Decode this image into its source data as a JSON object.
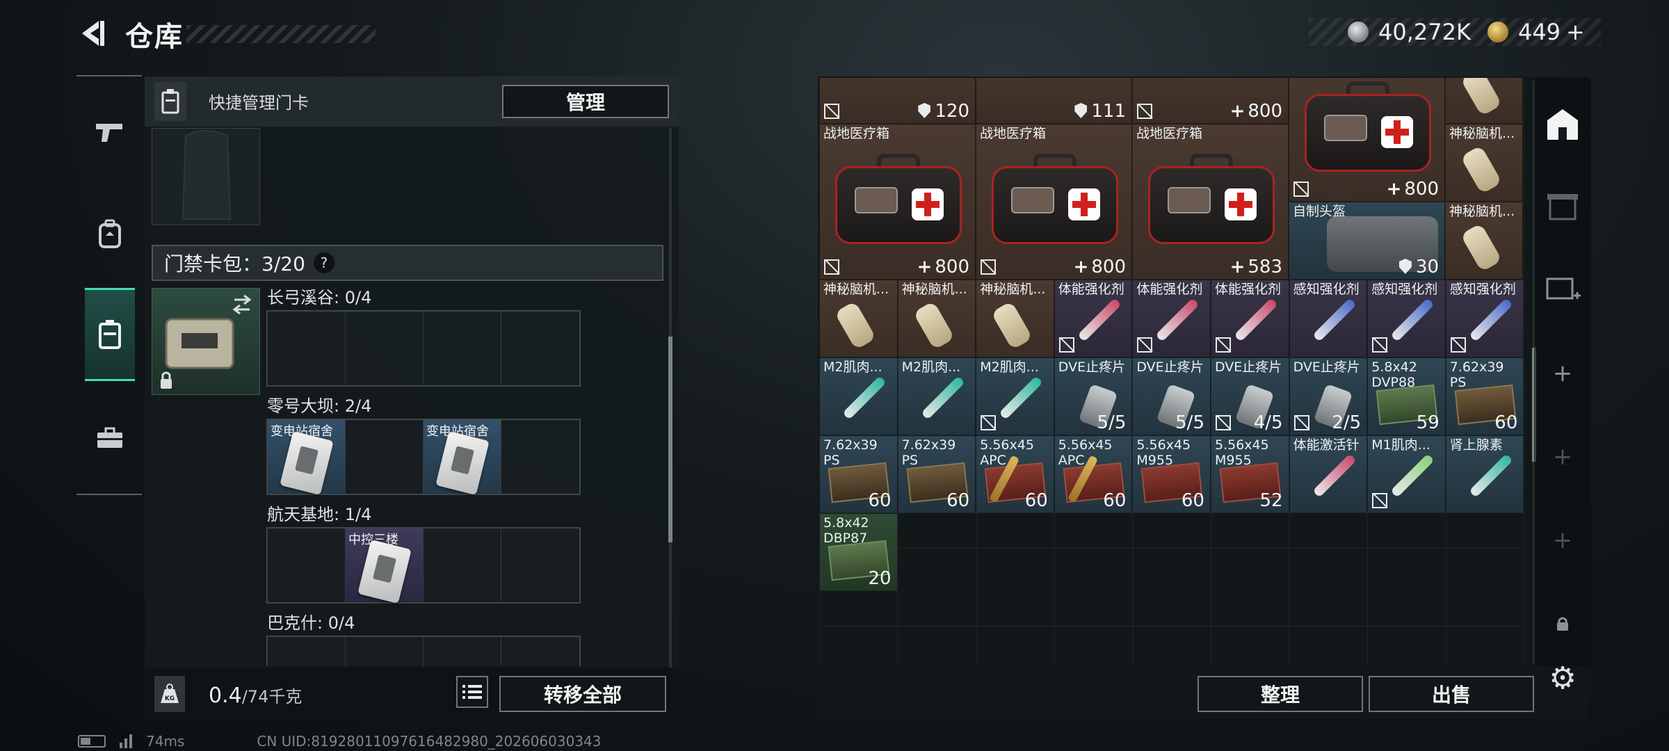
{
  "header": {
    "title": "仓库",
    "currency_silver": "40,272K",
    "currency_gold": "449",
    "gold_add": "+"
  },
  "nav": [
    {
      "icon": "pistol-icon"
    },
    {
      "icon": "backpack-icon"
    },
    {
      "icon": "keycard-icon",
      "active": true
    },
    {
      "icon": "toolbox-icon"
    }
  ],
  "left": {
    "quick_label": "快捷管理门卡",
    "manage_label": "管理",
    "cardbag_label": "门禁卡包：3/20",
    "cardbag_help": "?",
    "regions": [
      {
        "label": "长弓溪谷: 0/4",
        "slots": [
          null,
          null,
          null,
          null
        ]
      },
      {
        "label": "零号大坝: 2/4",
        "slots": [
          {
            "name": "变电站宿舍"
          },
          null,
          {
            "name": "变电站宿舍"
          },
          null
        ]
      },
      {
        "label": "航天基地: 1/4",
        "slots": [
          null,
          {
            "name": "中控三楼"
          },
          null,
          null
        ]
      },
      {
        "label": "巴克什: 0/4",
        "slots": [
          null,
          null,
          null,
          null
        ]
      }
    ],
    "weight_value": "0.4",
    "weight_max": "/74千克",
    "transfer_label": "转移全部"
  },
  "status": {
    "ping": "74ms",
    "uid": "CN UID:8192801109761648298​0_202606030343"
  },
  "right": {
    "top_row": [
      {
        "count": "120",
        "kind": "shield"
      },
      {
        "count": "111",
        "kind": "shield"
      },
      {
        "count": "800",
        "kind": "plus"
      }
    ],
    "items": [
      {
        "name": "战地医疗箱",
        "count": "800",
        "kind": "plus"
      },
      {
        "name": "战地医疗箱",
        "count": "800",
        "kind": "plus"
      },
      {
        "name": "战地医疗箱",
        "count": "583",
        "kind": "plus"
      },
      {
        "name": "",
        "count": "800",
        "kind": "plus"
      },
      {
        "name": "神秘脑机...",
        "count": ""
      },
      {
        "name": "神秘脑机...",
        "count": ""
      },
      {
        "name": "自制头盔",
        "count": "30",
        "kind": "shield"
      },
      {
        "name": "神秘脑机...",
        "count": ""
      },
      {
        "name": "神秘脑机...",
        "count": ""
      },
      {
        "name": "神秘脑机...",
        "count": ""
      },
      {
        "name": "体能强化剂",
        "count": ""
      },
      {
        "name": "体能强化剂",
        "count": ""
      },
      {
        "name": "体能强化剂",
        "count": ""
      },
      {
        "name": "感知强化剂",
        "count": ""
      },
      {
        "name": "感知强化剂",
        "count": ""
      },
      {
        "name": "感知强化剂",
        "count": ""
      },
      {
        "name": "M2肌肉...",
        "count": ""
      },
      {
        "name": "M2肌肉...",
        "count": ""
      },
      {
        "name": "M2肌肉...",
        "count": ""
      },
      {
        "name": "DVE止疼片",
        "count": "5/5"
      },
      {
        "name": "DVE止疼片",
        "count": "5/5"
      },
      {
        "name": "DVE止疼片",
        "count": "4/5"
      },
      {
        "name": "DVE止疼片",
        "count": "2/5"
      },
      {
        "name": "5.8x42\nDVP88",
        "count": "59"
      },
      {
        "name": "7.62x39\nPS",
        "count": "60"
      },
      {
        "name": "7.62x39\nPS",
        "count": "60"
      },
      {
        "name": "7.62x39\nPS",
        "count": "60"
      },
      {
        "name": "5.56x45\nAPC",
        "count": "60"
      },
      {
        "name": "5.56x45\nAPC",
        "count": "60"
      },
      {
        "name": "5.56x45\nM955",
        "count": "60"
      },
      {
        "name": "5.56x45\nM955",
        "count": "52"
      },
      {
        "name": "体能激活针",
        "count": ""
      },
      {
        "name": "M1肌肉...",
        "count": ""
      },
      {
        "name": "肾上腺素",
        "count": ""
      },
      {
        "name": "5.8x42\nDBP87",
        "count": "20"
      }
    ],
    "sort_label": "整理",
    "sell_label": "出售"
  },
  "toolbar": [
    {
      "icon": "home-storage-icon"
    },
    {
      "icon": "storage-box-icon"
    },
    {
      "icon": "add-storage-icon"
    },
    {
      "icon": "plus-icon"
    },
    {
      "icon": "plus-icon"
    },
    {
      "icon": "plus-icon"
    },
    {
      "icon": "lock-icon"
    },
    {
      "icon": "gear-icon"
    }
  ]
}
